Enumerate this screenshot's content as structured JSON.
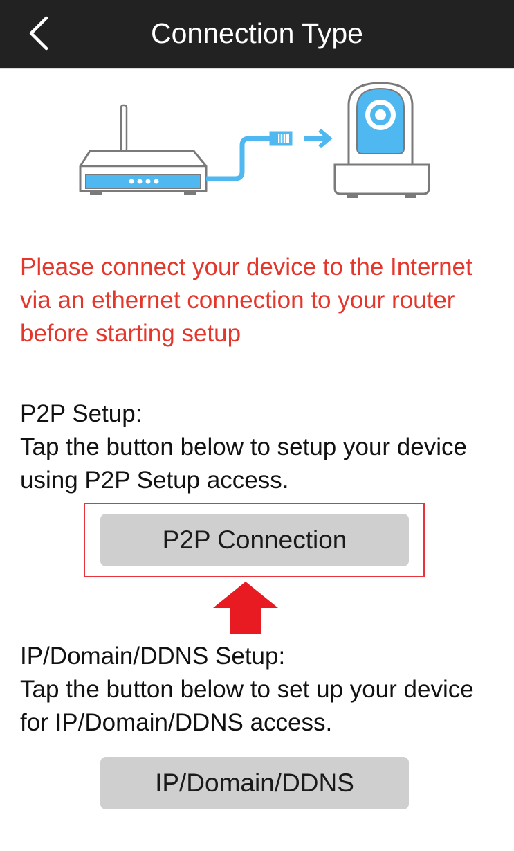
{
  "header": {
    "title": "Connection Type",
    "back_icon": "chevron-left-icon"
  },
  "illustration": {
    "router_icon": "router-icon",
    "camera_icon": "ip-camera-icon",
    "cable_icon": "ethernet-cable-icon",
    "arrow_icon": "arrow-right-icon"
  },
  "warning": {
    "text": "Please connect your device to the Internet via an ethernet connection to your router before starting setup",
    "color": "#e5362b"
  },
  "p2p": {
    "heading": "P2P Setup:",
    "description": "Tap the button below to setup your device using P2P Setup access.",
    "button_label": "P2P Connection"
  },
  "ip": {
    "heading": "IP/Domain/DDNS Setup:",
    "description": "Tap the button below to set up your device for IP/Domain/DDNS access.",
    "button_label": "IP/Domain/DDNS"
  },
  "annotation": {
    "highlight_color": "#e8333b",
    "pointer_icon": "arrow-up-icon"
  },
  "colors": {
    "navbar": "#222222",
    "accent_blue": "#4fb8f0",
    "button_gray": "#cfcfcf"
  }
}
